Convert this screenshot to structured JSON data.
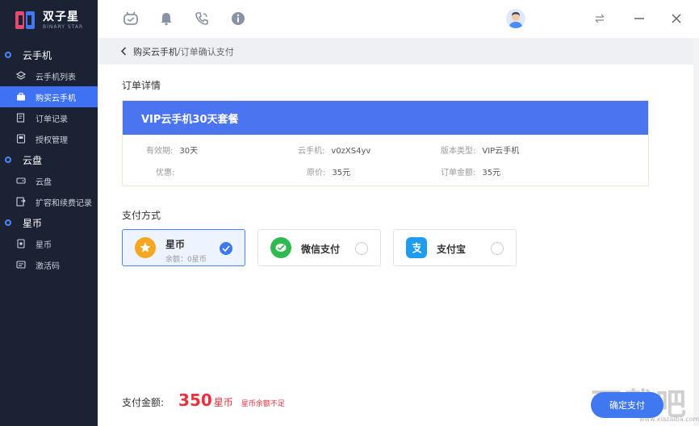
{
  "app": {
    "name": "双子星",
    "subtitle": "BINARY STAR"
  },
  "sidebar": {
    "groups": [
      {
        "label": "云手机",
        "items": [
          {
            "label": "云手机列表"
          },
          {
            "label": "购买云手机"
          },
          {
            "label": "订单记录"
          },
          {
            "label": "授权管理"
          }
        ]
      },
      {
        "label": "云盘",
        "items": [
          {
            "label": "云盘"
          },
          {
            "label": "扩容和续费记录"
          }
        ]
      },
      {
        "label": "星币",
        "items": [
          {
            "label": "星币"
          },
          {
            "label": "激活码"
          }
        ]
      }
    ],
    "active_item": "购买云手机"
  },
  "topbar": {
    "icons": [
      "robot-icon",
      "bell-icon",
      "phone-icon",
      "info-icon"
    ]
  },
  "breadcrumb": {
    "parent": "购买云手机",
    "separator": "/",
    "current": "订单确认支付"
  },
  "order": {
    "section_title": "订单详情",
    "package_name": "VIP云手机30天套餐",
    "fields": {
      "validity_label": "有效期:",
      "validity_value": "30天",
      "phone_label": "云手机:",
      "phone_value": "v0zXS4yv",
      "version_label": "版本类型:",
      "version_value": "VIP云手机",
      "discount_label": "优惠:",
      "discount_value": "",
      "original_label": "原价:",
      "original_value": "35元",
      "total_label": "订单金额:",
      "total_value": "35元"
    }
  },
  "payment": {
    "section_title": "支付方式",
    "methods": [
      {
        "name": "星币",
        "balance": "余额：0星币",
        "selected": true,
        "color": "#f5a623"
      },
      {
        "name": "微信支付",
        "selected": false,
        "color": "#2fb94e"
      },
      {
        "name": "支付宝",
        "selected": false,
        "color": "#1f9bf0"
      }
    ]
  },
  "footer": {
    "total_label": "支付金额:",
    "amount": "350",
    "unit": "星币",
    "warning": "星币余额不足",
    "confirm_label": "确定支付"
  },
  "watermark": {
    "text": "下载吧",
    "sub": "www.xiazaiba.com"
  },
  "colors": {
    "sidebar_bg": "#1b2233",
    "accent": "#3f78f0",
    "order_header": "#4a74f0",
    "warning": "#e8323c"
  }
}
